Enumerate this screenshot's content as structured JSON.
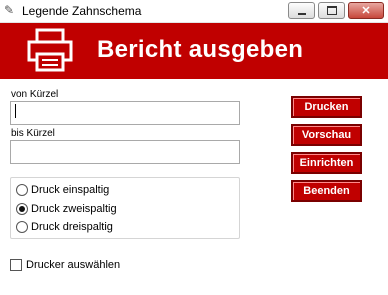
{
  "window": {
    "title": "Legende Zahnschema",
    "close_glyph": "✕"
  },
  "banner": {
    "title": "Bericht ausgeben",
    "color": "#c00000",
    "icon": "printer-icon"
  },
  "form": {
    "from_label": "von Kürzel",
    "from_value": "",
    "to_label": "bis Kürzel",
    "to_value": ""
  },
  "buttons": [
    {
      "label": "Drucken"
    },
    {
      "label": "Vorschau"
    },
    {
      "label": "Einrichten"
    },
    {
      "label": "Beenden"
    }
  ],
  "print_mode": {
    "options": [
      {
        "label": "Druck einspaltig",
        "checked": false
      },
      {
        "label": "Druck zweispaltig",
        "checked": true
      },
      {
        "label": "Druck dreispaltig",
        "checked": false
      }
    ]
  },
  "printer_select": {
    "label": "Drucker auswählen",
    "checked": false
  }
}
